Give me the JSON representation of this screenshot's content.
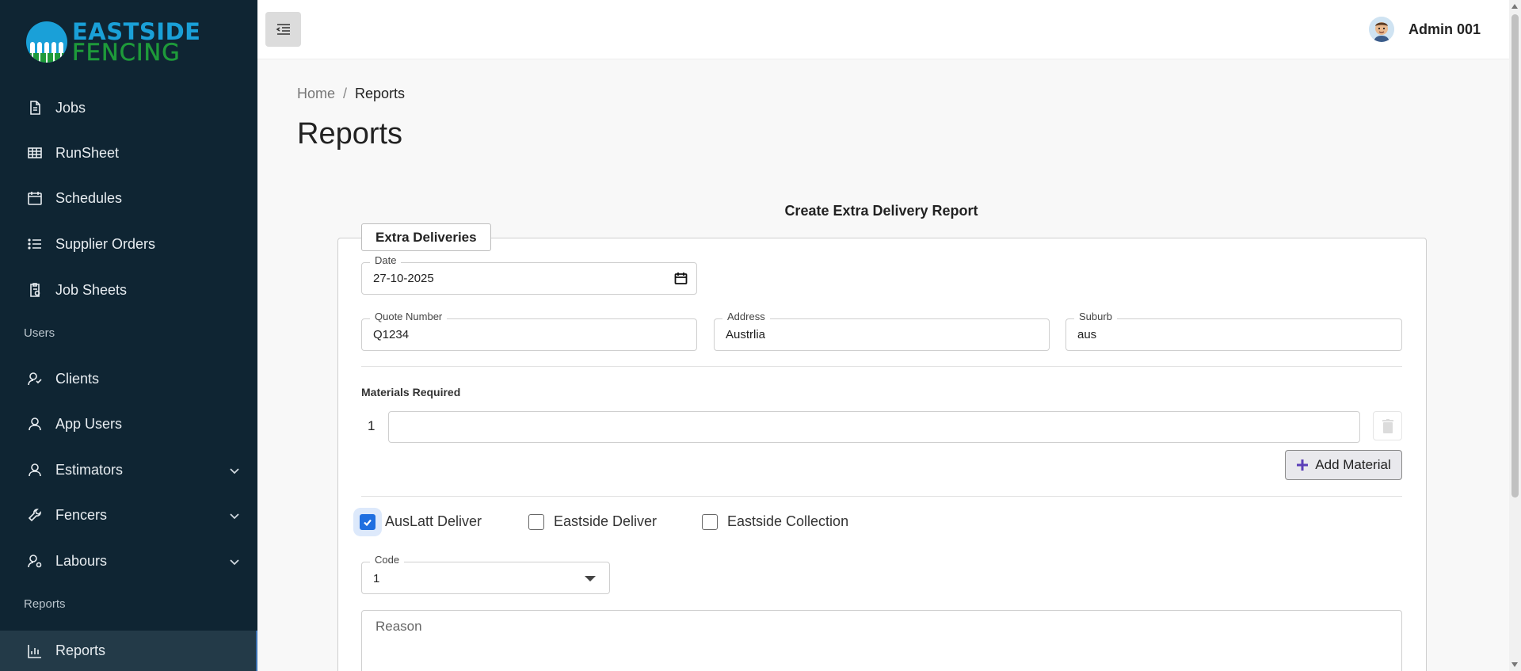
{
  "brand": {
    "line1": "EASTSIDE",
    "line2": "FENCING"
  },
  "sidebar": {
    "items": [
      {
        "label": "Jobs",
        "icon": "file-icon"
      },
      {
        "label": "RunSheet",
        "icon": "table-icon"
      },
      {
        "label": "Schedules",
        "icon": "calendar-icon"
      },
      {
        "label": "Supplier Orders",
        "icon": "list-icon"
      },
      {
        "label": "Job Sheets",
        "icon": "clipboard-icon"
      },
      {
        "label": "Clients",
        "icon": "users-icon"
      },
      {
        "label": "App Users",
        "icon": "user-icon"
      },
      {
        "label": "Estimators",
        "icon": "user-icon"
      },
      {
        "label": "Fencers",
        "icon": "wrench-icon"
      },
      {
        "label": "Labours",
        "icon": "users-icon"
      },
      {
        "label": "Reports",
        "icon": "chart-icon"
      }
    ],
    "sections": {
      "users": "Users",
      "reports": "Reports"
    }
  },
  "header": {
    "user_name": "Admin 001"
  },
  "breadcrumb": {
    "home": "Home",
    "sep": "/",
    "current": "Reports"
  },
  "page": {
    "title": "Reports"
  },
  "form": {
    "title": "Create Extra Delivery Report",
    "legend": "Extra Deliveries",
    "date": {
      "label": "Date",
      "value": "27-10-2025"
    },
    "quote_number": {
      "label": "Quote Number",
      "value": "Q1234"
    },
    "address": {
      "label": "Address",
      "value": "Austrlia"
    },
    "suburb": {
      "label": "Suburb",
      "value": "aus"
    },
    "materials_label": "Materials Required",
    "materials": [
      {
        "index": "1",
        "value": ""
      }
    ],
    "add_material_label": "Add Material",
    "checkboxes": [
      {
        "label": "AusLatt Deliver",
        "checked": true
      },
      {
        "label": "Eastside Deliver",
        "checked": false
      },
      {
        "label": "Eastside Collection",
        "checked": false
      }
    ],
    "code": {
      "label": "Code",
      "value": "1"
    },
    "reason": {
      "placeholder": "Reason"
    }
  },
  "colors": {
    "sidebar_bg": "#0f2533",
    "accent": "#1f6fe0",
    "brand_blue": "#1aa0d8",
    "brand_green": "#1e9a3a"
  }
}
